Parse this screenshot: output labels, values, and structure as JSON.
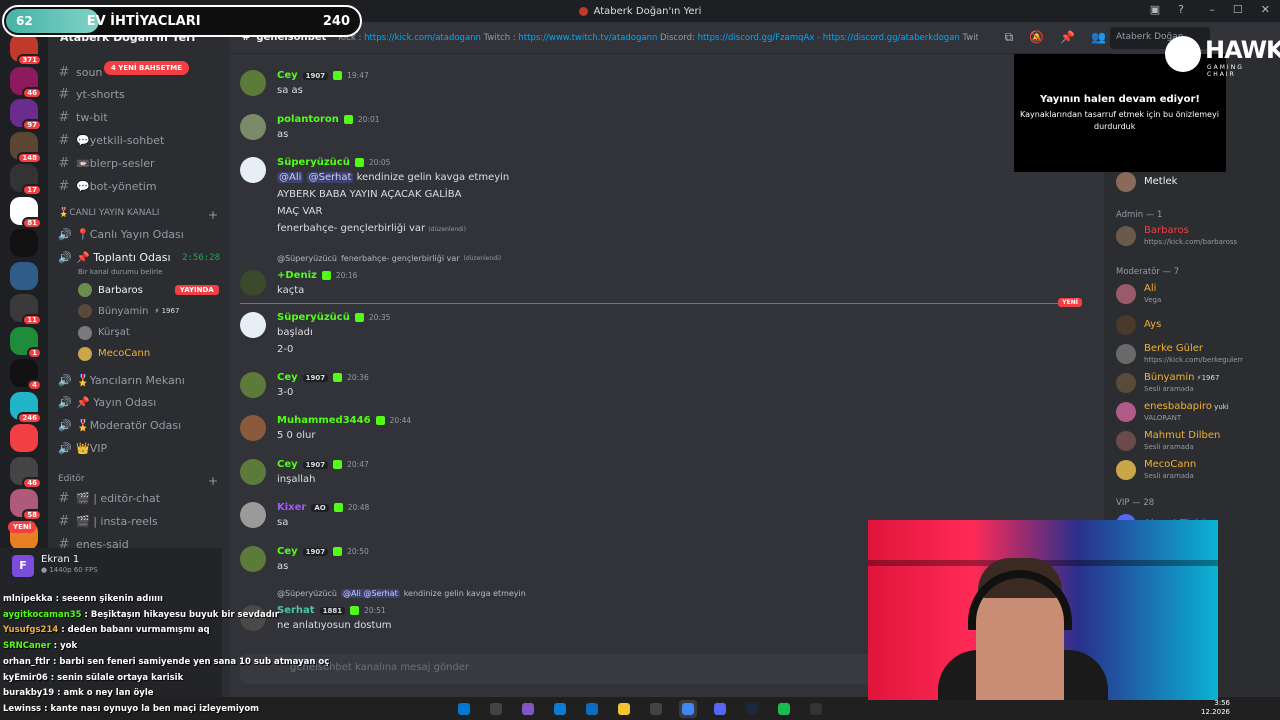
{
  "window": {
    "title": "Ataberk Doğan'ın Yeri"
  },
  "overlay": {
    "level": "62",
    "goal": "EV İHTİYACLARI",
    "count": "240",
    "progress": 0.26
  },
  "servers": [
    {
      "badge": "371",
      "color": "#c0392b"
    },
    {
      "badge": "46",
      "color": "#8e1a5e"
    },
    {
      "badge": "97",
      "color": "#6c2b8e"
    },
    {
      "badge": "148",
      "color": "#5a4632"
    },
    {
      "badge": "17",
      "color": "#333333"
    },
    {
      "badge": "81",
      "color": "#ffffff"
    },
    {
      "badge": "",
      "color": "#111111"
    },
    {
      "badge": "",
      "color": "#2f5d8a"
    },
    {
      "badge": "11",
      "color": "#3a3a3a"
    },
    {
      "badge": "1",
      "color": "#1e8c3a"
    },
    {
      "badge": "4",
      "color": "#111111"
    },
    {
      "badge": "246",
      "color": "#1fb4c6"
    },
    {
      "badge": "",
      "color": "#f23f43"
    },
    {
      "badge": "46",
      "color": "#444444"
    },
    {
      "badge": "58",
      "color": "#b05a7a"
    },
    {
      "badge": "",
      "color": "#e67e22"
    }
  ],
  "new_pill": "YENİ",
  "sidebar": {
    "server_name": "Ataberk Doğan'ın Yeri",
    "new_mentions": "4 YENİ BAHSETME",
    "text_channels": [
      "soun",
      "yt-shorts",
      "tw-bit",
      "💬yetkili-sohbet",
      "📼blerp-sesler",
      "💬bot-yönetim"
    ],
    "live_category": "🎖️CANLI YAYIN KANALI",
    "live_voice": "📍Canlı Yayın Odası",
    "meeting_room": "📌 Toplantı Odası",
    "meeting_timer": "2:56:28",
    "meeting_status": "Bir kanal durumu belirle",
    "vc_users": [
      {
        "name": "Barbaros",
        "live": "YAYINDA",
        "color": "#f2f3f5"
      },
      {
        "name": "Bünyamin",
        "tag": "⚡ 1967",
        "color": "#949ba4"
      },
      {
        "name": "Kürşat",
        "color": "#949ba4"
      },
      {
        "name": "MecoCann",
        "color": "#f0b232"
      }
    ],
    "voice_rooms": [
      "🎖️Yancıların Mekanı",
      "📌 Yayın Odası",
      "🎖️Moderatör Odası",
      "👑VIP"
    ],
    "editor_category": "Editör",
    "editor_channels": [
      "🎬 | editör-chat",
      "🎬 | insta-reels",
      "enes-said"
    ],
    "screen_share": {
      "label": "Ekran 1",
      "sub": "● 1440p 60 FPS",
      "icon": "F"
    }
  },
  "chatlog": [
    {
      "user": "mlnipekka",
      "text": "seeenn şikenin adııııı",
      "color": "#ffffff"
    },
    {
      "user": "aygitkocaman35",
      "text": "Beşiktaşın hikayesu buyuk bir sevdadır",
      "color": "#53fc18"
    },
    {
      "user": "Yusufgs214",
      "text": "deden babanı vurmamışmı aq",
      "color": "#f0b232"
    },
    {
      "user": "SRNCaner",
      "text": "yok",
      "color": "#53fc18"
    },
    {
      "user": "orhan_ftlr",
      "text": "barbi sen feneri samiyende yen sana 10 sub atmayan oç",
      "color": "#ffffff"
    },
    {
      "user": "kyEmir06",
      "text": "senin sülale ortaya karisik",
      "color": "#ffffff"
    },
    {
      "user": "burakby19",
      "text": "amk o ney lan öyle",
      "color": "#ffffff"
    },
    {
      "user": "Lewinss",
      "text": "kante nası oynuyo la ben maçi izleyemiyom",
      "color": "#ffffff"
    }
  ],
  "topbar": {
    "channel": "genelsohbet",
    "topic_prefix": "Kick : ",
    "kick_url": "https://kick.com/atadogann",
    "twitch_label": " Twitch : ",
    "twitch_url": "https://www.twitch.tv/atadogann",
    "discord_label": " Discord: ",
    "discord_url": "https://discord.gg/FzamqAx - https://discord.gg/ataberkdogan",
    "twitter_label": " Twitter : ht..."
  },
  "search_placeholder": "Ataberk Doğan",
  "messages": [
    {
      "name": "Cey",
      "color": "#53fc18",
      "tag": "1907",
      "time": "19:47",
      "lines": [
        "sa as"
      ]
    },
    {
      "name": "polantoron",
      "color": "#53fc18",
      "time": "20:01",
      "lines": [
        "as"
      ]
    },
    {
      "name": "Süperyüzücü",
      "color": "#53fc18",
      "time": "20:05",
      "mentions": [
        "@Ali",
        "@Serhat"
      ],
      "first_line": "kendinize gelin kavga etmeyin",
      "lines": [
        "AYBERK BABA YAYIN AÇACAK GALİBA",
        "MAÇ VAR",
        "fenerbahçe- gençlerbirliği var"
      ],
      "edited": "(düzenlendi)"
    },
    {
      "name": "+Deniz",
      "color": "#53fc18",
      "time": "20:16",
      "reply_user": "@Süperyüzücü",
      "reply_text": "fenerbahçe- gençlerbirliği var",
      "reply_edited": "(düzenlendi)",
      "lines": [
        "kaçta"
      ]
    },
    {
      "name": "Süperyüzücü",
      "color": "#53fc18",
      "time": "20:35",
      "lines": [
        "başladı",
        "2-0"
      ]
    },
    {
      "name": "Cey",
      "color": "#53fc18",
      "tag": "1907",
      "time": "20:36",
      "lines": [
        "3-0"
      ]
    },
    {
      "name": "Muhammed3446",
      "color": "#53fc18",
      "time": "20:44",
      "lines": [
        "5 0 olur"
      ]
    },
    {
      "name": "Cey",
      "color": "#53fc18",
      "tag": "1907",
      "time": "20:47",
      "lines": [
        "inşallah"
      ]
    },
    {
      "name": "Kixer",
      "color": "#a259ff",
      "tag": "AO",
      "time": "20:48",
      "lines": [
        "sa"
      ]
    },
    {
      "name": "Cey",
      "color": "#53fc18",
      "tag": "1907",
      "time": "20:50",
      "lines": [
        "as"
      ]
    },
    {
      "name": "Serhat",
      "color": "#49c6a5",
      "tag": "1881",
      "time": "20:51",
      "reply_user": "@Süperyüzücü",
      "reply_mentions": "@Ali @Serhat",
      "reply_text": "kendinize gelin kavga etmeyin",
      "lines": [
        "ne anlatıyosun dostum"
      ]
    }
  ],
  "new_divider": "YENİ",
  "composer_placeholder": "genelsohbet kanalına mesaj gönder",
  "stream_note": {
    "title": "Yayının halen devam ediyor!",
    "line1": "Kaynaklarından tasarruf etmek için bu önizlemeyi",
    "line2": "durdurduk"
  },
  "hawk": {
    "word": "HAWK",
    "sub": "GAMING CHAIR"
  },
  "members": {
    "top": [
      {
        "name": "Metlek",
        "color": "#f2f3f5",
        "status": ""
      }
    ],
    "admin_label": "Admin — 1",
    "admins": [
      {
        "name": "Barbaros",
        "color": "#f23f43",
        "status": "https://kick.com/barbaross"
      }
    ],
    "mod_label": "Moderatör — 7",
    "mods": [
      {
        "name": "Ali",
        "color": "#f0b232",
        "status": "Vega"
      },
      {
        "name": "Ays",
        "color": "#f0b232",
        "status": ""
      },
      {
        "name": "Berke Güler",
        "color": "#f0b232",
        "status": "https://kick.com/berkegulerr"
      },
      {
        "name": "Bünyamin",
        "color": "#f0b232",
        "status": "Sesli aramada",
        "tag": "⚡1967"
      },
      {
        "name": "enesbabapiro",
        "color": "#f0b232",
        "status": "VALORANT",
        "tag": "yuki"
      },
      {
        "name": "Mahmut Dilben",
        "color": "#f0b232",
        "status": "Sesli aramada"
      },
      {
        "name": "MecoCann",
        "color": "#f0b232",
        "status": "Sesli aramada"
      }
    ],
    "vip_label": "VIP — 28",
    "vips": [
      {
        "name": "Ahmet Türkü",
        "color": "#5865f2",
        "status": ""
      }
    ]
  },
  "taskbar": {
    "icons": [
      "windows-icon",
      "search-icon",
      "copilot-icon",
      "edge-icon",
      "store-icon",
      "files-icon",
      "xbox-icon",
      "chrome-icon",
      "discord-icon",
      "steam-icon",
      "spotify-icon",
      "obs-icon"
    ],
    "time": "3:56",
    "date": "12.2026"
  }
}
